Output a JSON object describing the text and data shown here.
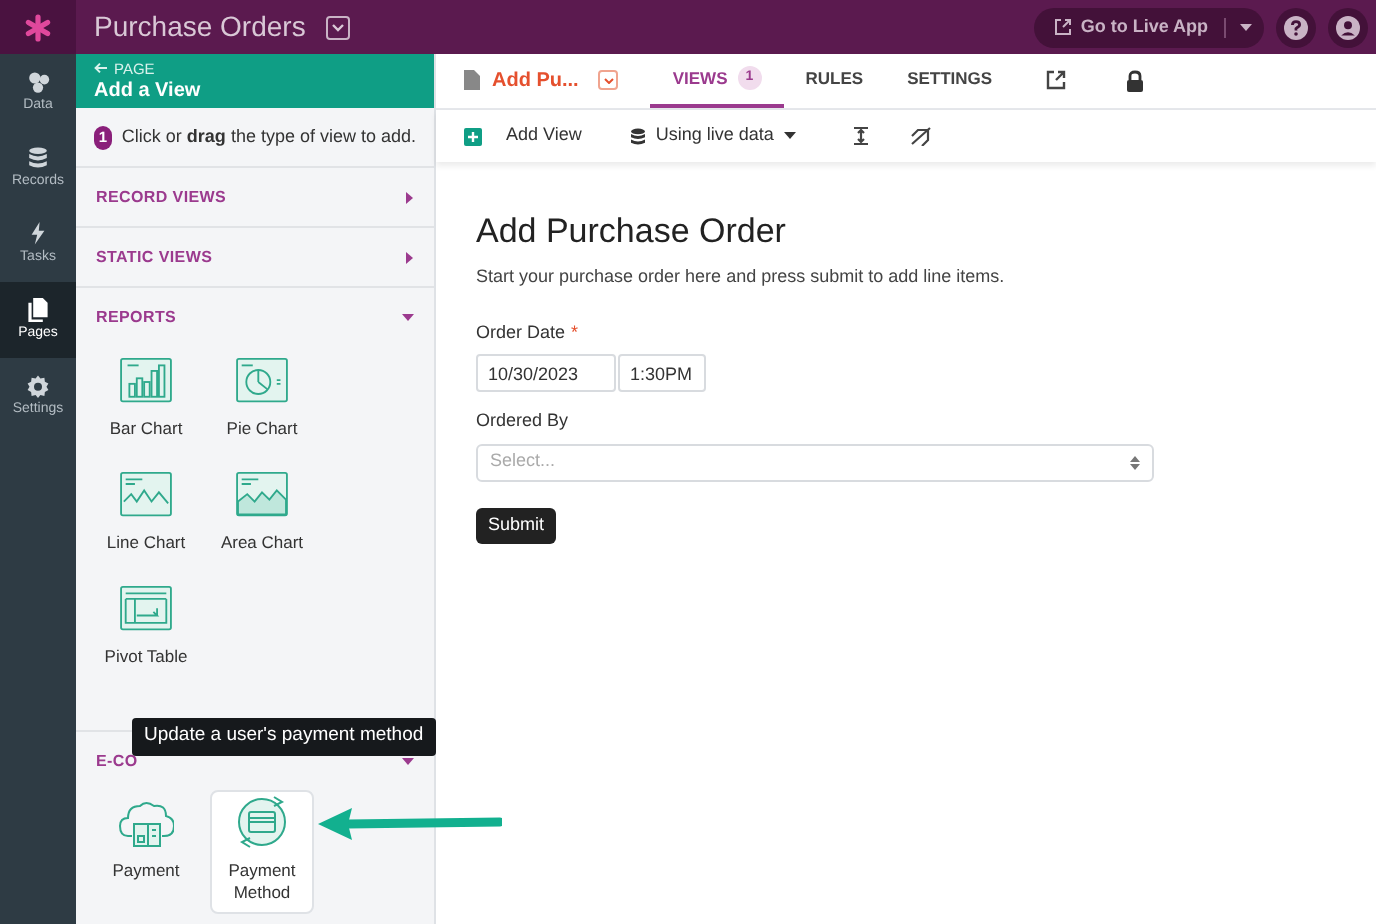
{
  "app": {
    "title": "Purchase Orders",
    "go_live": "Go to Live App"
  },
  "rail": [
    {
      "label": "Data",
      "selected": false
    },
    {
      "label": "Records",
      "selected": false
    },
    {
      "label": "Tasks",
      "selected": false
    },
    {
      "label": "Pages",
      "selected": true
    },
    {
      "label": "Settings",
      "selected": false
    }
  ],
  "panel": {
    "back": "PAGE",
    "title": "Add a View",
    "step": "1",
    "instruction": "Click or **drag** the type of view to add."
  },
  "sections": [
    {
      "label": "RECORD VIEWS",
      "expanded": false
    },
    {
      "label": "STATIC VIEWS",
      "expanded": false
    },
    {
      "label": "REPORTS",
      "expanded": true,
      "items": [
        {
          "label": "Bar Chart",
          "kind": "bar",
          "selected": false
        },
        {
          "label": "Pie Chart",
          "kind": "pie",
          "selected": false
        },
        {
          "label": "Line Chart",
          "kind": "line",
          "selected": false
        },
        {
          "label": "Area Chart",
          "kind": "area",
          "selected": false
        },
        {
          "label": "Pivot Table",
          "kind": "pivot",
          "selected": false
        }
      ]
    },
    {
      "label": "E-CO",
      "expanded": true,
      "items": [
        {
          "label": "Payment",
          "kind": "payment",
          "selected": false
        },
        {
          "label": "Payment Method",
          "kind": "method",
          "selected": true
        }
      ]
    }
  ],
  "tooltip": "Update a user's payment method",
  "page_tab": {
    "title": "Add Pu..."
  },
  "tabs": [
    {
      "label": "VIEWS",
      "count": "1",
      "selected": true
    },
    {
      "label": "RULES",
      "selected": false
    },
    {
      "label": "SETTINGS",
      "selected": false
    }
  ],
  "toolbar": {
    "add_view": "Add View",
    "data_mode": "Using live data"
  },
  "form": {
    "title": "Add Purchase Order",
    "description": "Start your purchase order here and press submit to add line items.",
    "fields": [
      {
        "kind": "datetime",
        "label": "Order Date",
        "required_mark": "*",
        "date": "10/30/2023",
        "time": "1:30PM"
      },
      {
        "kind": "select",
        "label": "Ordered By",
        "placeholder": "Select..."
      }
    ],
    "submit": "Submit"
  }
}
